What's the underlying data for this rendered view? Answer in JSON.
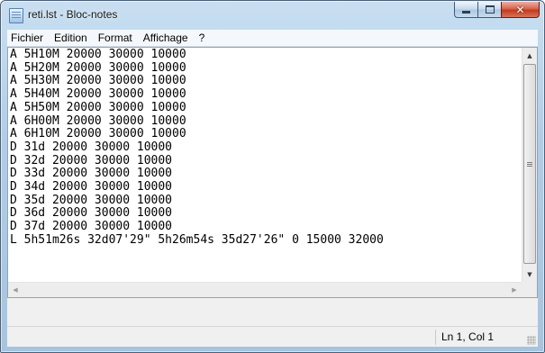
{
  "window": {
    "title": "reti.lst - Bloc-notes",
    "minimize_icon": "minimize-icon",
    "maximize_icon": "maximize-icon",
    "close_icon": "close-icon"
  },
  "menu": [
    {
      "label": "Fichier"
    },
    {
      "label": "Edition"
    },
    {
      "label": "Format"
    },
    {
      "label": "Affichage"
    },
    {
      "label": "?"
    }
  ],
  "document": {
    "lines": [
      "A 5H10M 20000 30000 10000",
      "A 5H20M 20000 30000 10000",
      "A 5H30M 20000 30000 10000",
      "A 5H40M 20000 30000 10000",
      "A 5H50M 20000 30000 10000",
      "A 6H00M 20000 30000 10000",
      "A 6H10M 20000 30000 10000",
      "D 31d 20000 30000 10000",
      "D 32d 20000 30000 10000",
      "D 33d 20000 30000 10000",
      "D 34d 20000 30000 10000",
      "D 35d 20000 30000 10000",
      "D 36d 20000 30000 10000",
      "D 37d 20000 30000 10000",
      "L 5h51m26s 32d07'29\" 5h26m54s 35d27'26\" 0 15000 32000"
    ]
  },
  "statusbar": {
    "position": "Ln 1, Col 1"
  },
  "scrollbars": {
    "up_glyph": "▲",
    "down_glyph": "▼",
    "left_glyph": "◀",
    "right_glyph": "▶"
  },
  "colors": {
    "titlebar": "#b1cde6",
    "close_button": "#c23a1d",
    "text": "#000000"
  }
}
